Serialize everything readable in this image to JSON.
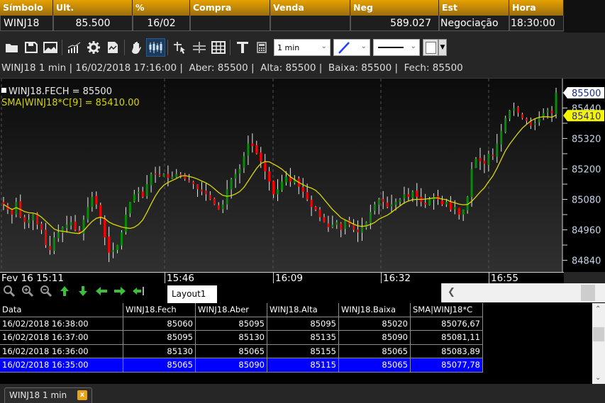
{
  "quote": {
    "headers": [
      "Símbolo",
      "Ult.",
      "%",
      "Compra",
      "Venda",
      "Neg",
      "Est",
      "Hora"
    ],
    "values": [
      "WINJ18",
      "85.500",
      "16/02",
      "",
      "",
      "589.027",
      "Negociação",
      "18:30:00"
    ]
  },
  "toolbar": {
    "icons": [
      "open-folder-icon",
      "save-icon",
      "image-icon",
      "indicators-icon",
      "settings-icon",
      "template-icon",
      "pan-hand-icon",
      "candles-icon",
      "select-cursor-icon",
      "crosshair-icon",
      "grid-icon",
      "text-icon",
      "calculator-icon"
    ],
    "interval_value": "1 min",
    "line_color": "#1f3fff",
    "line_style": "solid",
    "fill_color": "#ffffff"
  },
  "info_line": "WINJ18 1 min | 16/02/2018 17:16:00 |  Aber: 85500 |  Alta: 85500 |  Baixa: 85500 |  Fech: 85500",
  "legend": {
    "close_label": "WINJ18.FECH = 85500",
    "sma_label": "SMA|WINJ18*C[9] = 85410.00"
  },
  "layout_tab": "Layout1",
  "doc_tab": "WINJ18 1 min",
  "doc_tab_close": "x",
  "nav_icons": [
    "zoom-reset-icon",
    "zoom-in-icon",
    "zoom-out-icon",
    "arrow-up-icon",
    "arrow-down-icon",
    "arrow-left-icon",
    "arrow-right-icon",
    "go-to-end-icon"
  ],
  "grid": {
    "headers": [
      "Data",
      "WINJ18.Fech",
      "WINJ18.Aber",
      "WINJ18.Alta",
      "WINJ18.Baixa",
      "SMA|WINJ18*C"
    ],
    "rows": [
      [
        "16/02/2018 16:38:00",
        "85060",
        "85095",
        "85095",
        "85020",
        "85076,67"
      ],
      [
        "16/02/2018 16:37:00",
        "85095",
        "85130",
        "85135",
        "85090",
        "85081,11"
      ],
      [
        "16/02/2018 16:36:00",
        "85130",
        "85065",
        "85155",
        "85065",
        "85083,89"
      ],
      [
        "16/02/2018 16:35:00",
        "85065",
        "85090",
        "85115",
        "85065",
        "85077,78"
      ]
    ],
    "selected_row": 3
  },
  "chart_data": {
    "type": "candlestick",
    "title": "WINJ18 1 min",
    "xlabel": "",
    "ylabel": "",
    "ylim": [
      84800,
      85540
    ],
    "y_ticks": [
      85500,
      85440,
      85320,
      85200,
      85080,
      84960,
      84840
    ],
    "x_tick_labels": [
      "Fev 16 15:11",
      "15:46",
      "16:09",
      "16:32",
      "16:55"
    ],
    "last_price_label": "85500",
    "sma_price_label": "85410",
    "colors": {
      "up": "#0a8a0a",
      "down": "#ff0000",
      "wick": "#e8e8e8",
      "sma": "#d8d800"
    },
    "sma_period": 9,
    "closes": [
      85060,
      85040,
      85020,
      85070,
      85010,
      84990,
      85000,
      85020,
      84980,
      84960,
      84900,
      84880,
      84930,
      84950,
      84970,
      84980,
      84990,
      84960,
      84950,
      85000,
      85050,
      85090,
      85060,
      85010,
      84930,
      84870,
      84880,
      84900,
      84950,
      85020,
      85070,
      85100,
      85110,
      85090,
      85140,
      85180,
      85180,
      85175,
      85180,
      85165,
      85170,
      85180,
      85175,
      85160,
      85150,
      85140,
      85120,
      85110,
      85100,
      85080,
      85060,
      85040,
      85060,
      85120,
      85160,
      85180,
      85200,
      85250,
      85300,
      85290,
      85260,
      85230,
      85190,
      85150,
      85100,
      85120,
      85150,
      85170,
      85150,
      85160,
      85130,
      85110,
      85080,
      85050,
      85040,
      85010,
      84990,
      84970,
      84980,
      84990,
      84960,
      85000,
      84980,
      84960,
      84950,
      84970,
      84990,
      85030,
      85060,
      85080,
      85070,
      85050,
      85060,
      85070,
      85080,
      85100,
      85090,
      85110,
      85090,
      85070,
      85060,
      85080,
      85090,
      85080,
      85060,
      85070,
      85040,
      85050,
      85020,
      85040,
      85090,
      85200,
      85240,
      85230,
      85220,
      85260,
      85250,
      85300,
      85350,
      85400,
      85430,
      85440,
      85420,
      85400,
      85390,
      85370,
      85380,
      85400,
      85420,
      85430,
      85420,
      85500
    ]
  }
}
